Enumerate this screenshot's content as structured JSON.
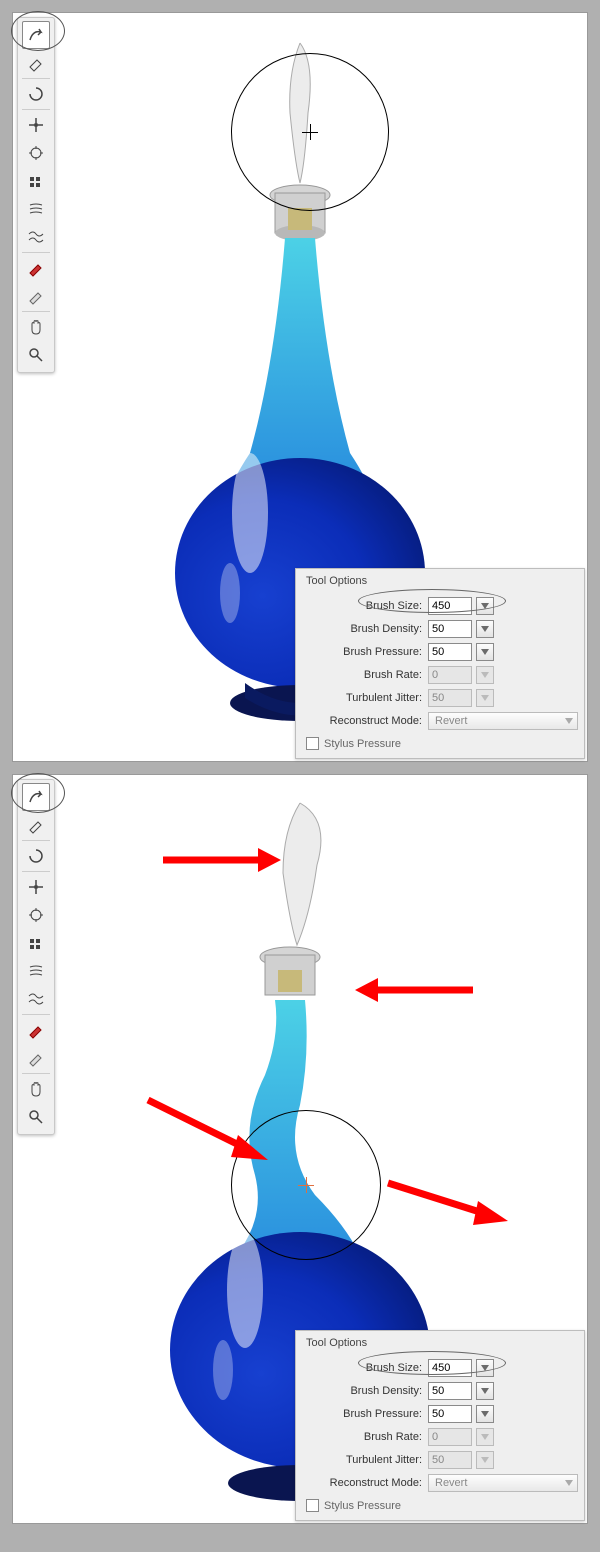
{
  "tool_options": {
    "title": "Tool Options",
    "labels": {
      "brush_size": "Brush Size:",
      "brush_density": "Brush Density:",
      "brush_pressure": "Brush Pressure:",
      "brush_rate": "Brush Rate:",
      "turbulent_jitter": "Turbulent Jitter:",
      "reconstruct_mode": "Reconstruct Mode:"
    },
    "values": {
      "brush_size": "450",
      "brush_density": "50",
      "brush_pressure": "50",
      "brush_rate": "0",
      "turbulent_jitter": "50",
      "reconstruct_mode": "Revert"
    },
    "stylus_label": "Stylus Pressure"
  },
  "tools": [
    "forward-warp",
    "reconstruct",
    "twirl-cw",
    "pucker",
    "bloat",
    "push-left",
    "mirror",
    "turbulence",
    "freeze-mask",
    "thaw-mask",
    "hand",
    "zoom"
  ]
}
